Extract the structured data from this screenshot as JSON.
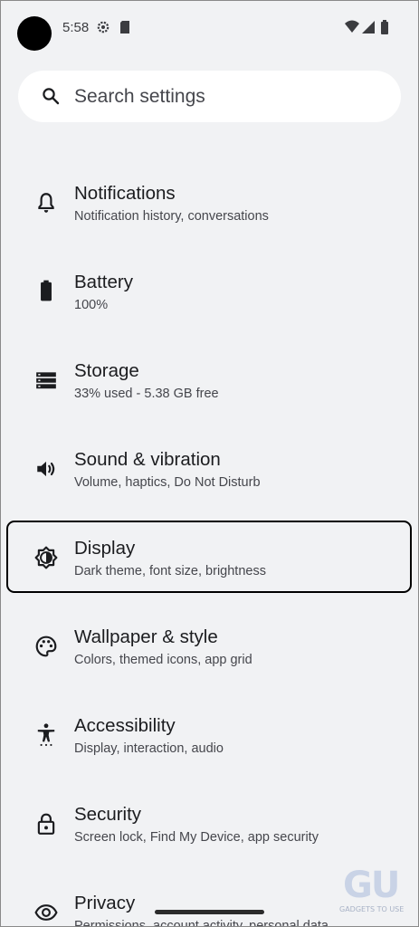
{
  "status_bar": {
    "time": "5:58"
  },
  "search": {
    "placeholder": "Search settings"
  },
  "items": [
    {
      "title": "Notifications",
      "subtitle": "Notification history, conversations",
      "icon": "bell-icon"
    },
    {
      "title": "Battery",
      "subtitle": "100%",
      "icon": "battery-icon"
    },
    {
      "title": "Storage",
      "subtitle": "33% used - 5.38 GB free",
      "icon": "storage-icon"
    },
    {
      "title": "Sound & vibration",
      "subtitle": "Volume, haptics, Do Not Disturb",
      "icon": "volume-icon"
    },
    {
      "title": "Display",
      "subtitle": "Dark theme, font size, brightness",
      "icon": "brightness-icon"
    },
    {
      "title": "Wallpaper & style",
      "subtitle": "Colors, themed icons, app grid",
      "icon": "palette-icon"
    },
    {
      "title": "Accessibility",
      "subtitle": "Display, interaction, audio",
      "icon": "accessibility-icon"
    },
    {
      "title": "Security",
      "subtitle": "Screen lock, Find My Device, app security",
      "icon": "lock-icon"
    },
    {
      "title": "Privacy",
      "subtitle": "Permissions, account activity, personal data",
      "icon": "eye-icon"
    }
  ],
  "watermark": {
    "logo": "GU",
    "caption": "GADGETS TO USE"
  }
}
